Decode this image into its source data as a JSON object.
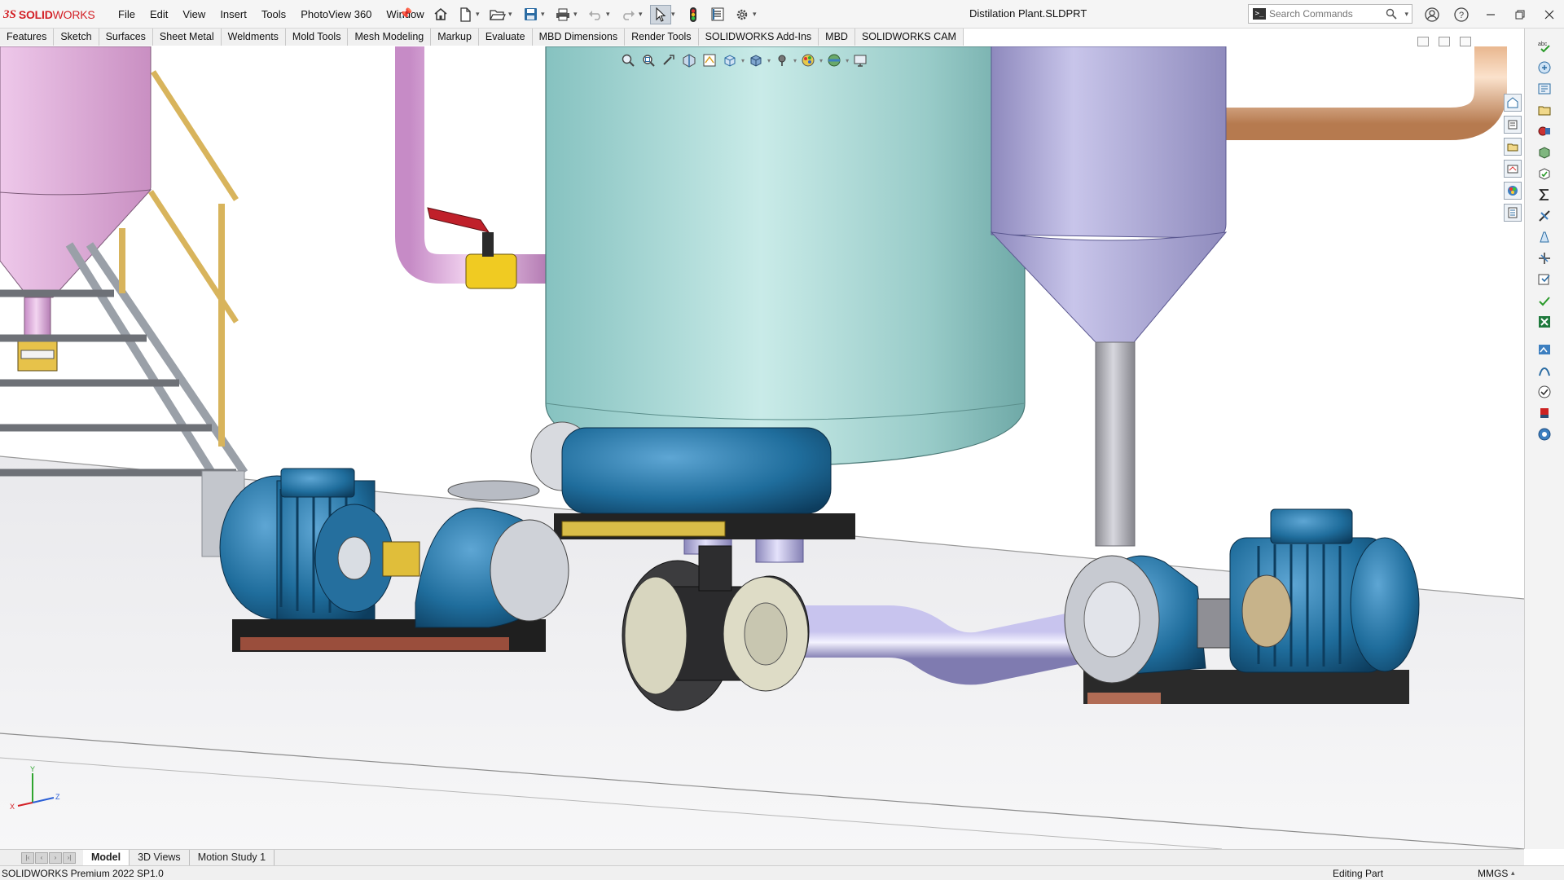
{
  "app": {
    "brand_ds": "3S",
    "brand_bold": "SOLID",
    "brand_light": "WORKS"
  },
  "menu": [
    "File",
    "Edit",
    "View",
    "Insert",
    "Tools",
    "PhotoView 360",
    "Window"
  ],
  "document_title": "Distilation Plant.SLDPRT",
  "search": {
    "placeholder": "Search Commands"
  },
  "command_tabs": [
    "Features",
    "Sketch",
    "Surfaces",
    "Sheet Metal",
    "Weldments",
    "Mold Tools",
    "Mesh Modeling",
    "Markup",
    "Evaluate",
    "MBD Dimensions",
    "Render Tools",
    "SOLIDWORKS Add-Ins",
    "MBD",
    "SOLIDWORKS CAM"
  ],
  "quick_access_icons": [
    "home-icon",
    "new-document-icon",
    "open-folder-icon",
    "save-icon",
    "print-icon",
    "undo-icon",
    "redo-icon",
    "select-arrow-icon",
    "rebuild-traffic-light-icon",
    "file-properties-icon",
    "options-gear-icon"
  ],
  "heads_up_icons": [
    "zoom-to-fit-icon",
    "zoom-to-area-icon",
    "previous-view-icon",
    "section-view-icon",
    "dynamic-annotation-icon",
    "view-orientation-icon",
    "display-style-icon",
    "hide-show-items-icon",
    "edit-appearance-icon",
    "apply-scene-icon",
    "view-settings-icon"
  ],
  "bottom_tabs": [
    {
      "label": "Model",
      "active": true
    },
    {
      "label": "3D Views",
      "active": false
    },
    {
      "label": "Motion Study 1",
      "active": false
    }
  ],
  "status": {
    "version": "SOLIDWORKS Premium 2022 SP1.0",
    "mode": "Editing Part",
    "units": "MMGS"
  },
  "triad": {
    "y": "Y",
    "z": "Z",
    "x": "X"
  },
  "colors": {
    "brand_red": "#d32026",
    "tank_teal": "#a8d6d4",
    "vessel_lavender": "#a9a5d3",
    "hopper_pink": "#e3b3df",
    "pump_blue": "#1f6d9c",
    "rail_gold": "#d8b45c",
    "pipe_copper": "#d49a6a"
  }
}
